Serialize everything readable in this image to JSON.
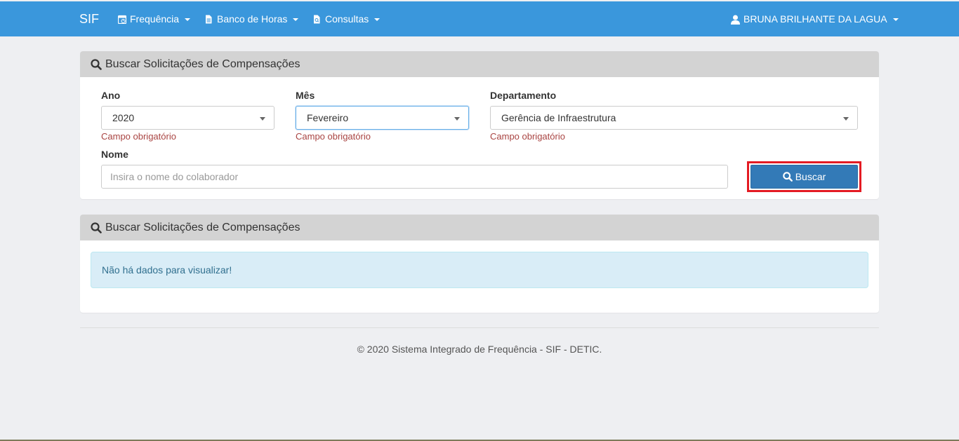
{
  "navbar": {
    "brand": "SIF",
    "items": [
      {
        "label": "Frequência",
        "icon": "calendar-clock-icon"
      },
      {
        "label": "Banco de Horas",
        "icon": "document-icon"
      },
      {
        "label": "Consultas",
        "icon": "document-search-icon"
      }
    ],
    "user": {
      "label": "BRUNA BRILHANTE DA LAGUA",
      "icon": "user-icon"
    },
    "color": "#3a97dc"
  },
  "search_panel": {
    "title": "Buscar Solicitações de Compensações",
    "ano": {
      "label": "Ano",
      "value": "2020",
      "error": "Campo obrigatório"
    },
    "mes": {
      "label": "Mês",
      "value": "Fevereiro",
      "error": "Campo obrigatório"
    },
    "departamento": {
      "label": "Departamento",
      "value": "Gerência de Infraestrutura",
      "error": "Campo obrigatório"
    },
    "nome": {
      "label": "Nome",
      "placeholder": "Insira o nome do colaborador",
      "value": ""
    },
    "search_button": "Buscar"
  },
  "results_panel": {
    "title": "Buscar Solicitações de Compensações",
    "empty_message": "Não há dados para visualizar!"
  },
  "footer": {
    "text": "© 2020 Sistema Integrado de Frequência - SIF - DETIC."
  }
}
